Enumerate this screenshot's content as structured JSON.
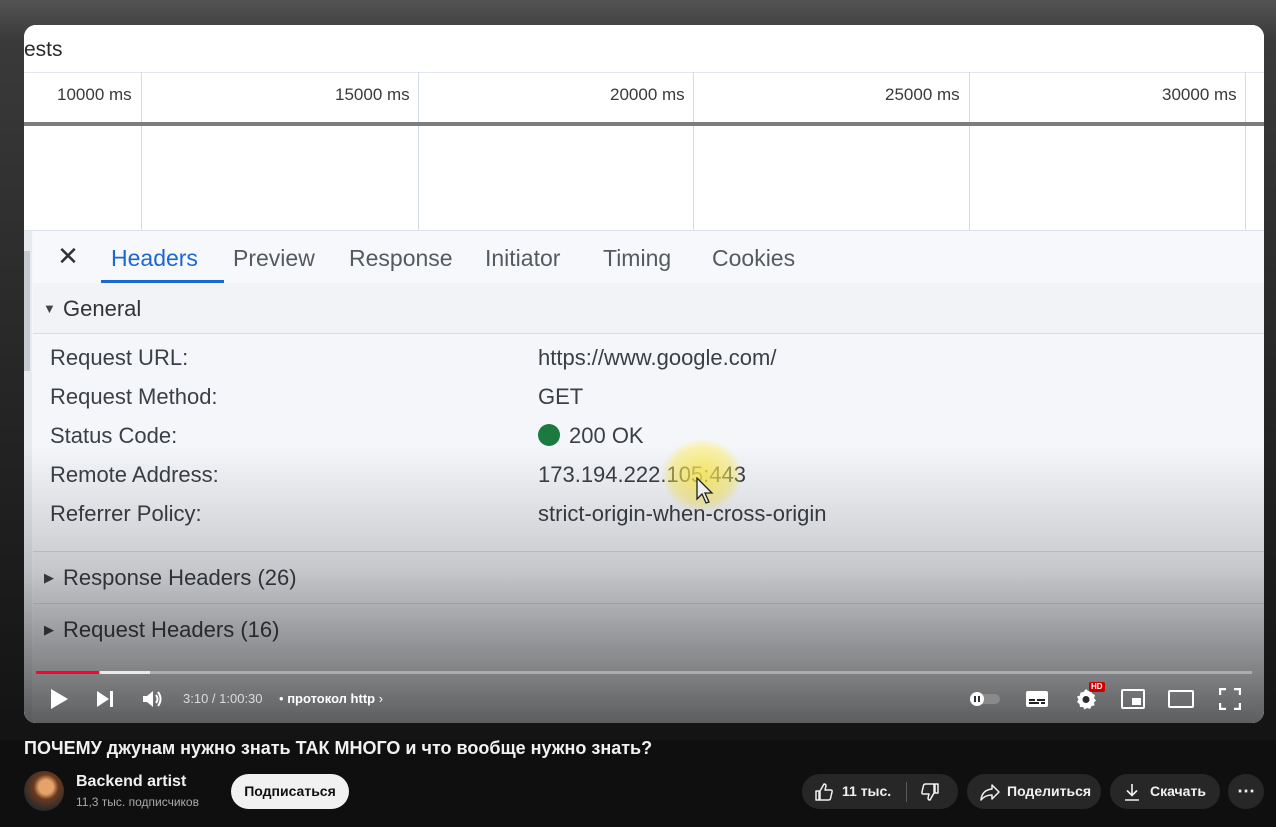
{
  "devtools": {
    "caption_fragment": "ests",
    "timeline_ticks": [
      "10000 ms",
      "15000 ms",
      "20000 ms",
      "25000 ms",
      "30000 ms"
    ],
    "tabs": [
      "Headers",
      "Preview",
      "Response",
      "Initiator",
      "Timing",
      "Cookies"
    ],
    "active_tab": "Headers",
    "general": {
      "title": "General",
      "rows": [
        {
          "key": "Request URL:",
          "value": "https://www.google.com/"
        },
        {
          "key": "Request Method:",
          "value": "GET"
        },
        {
          "key": "Status Code:",
          "value": "200 OK"
        },
        {
          "key": "Remote Address:",
          "value": "173.194.222.105:443"
        },
        {
          "key": "Referrer Policy:",
          "value": "strict-origin-when-cross-origin"
        }
      ]
    },
    "status_color": "#1b7a3f",
    "response_headers": "Response Headers (26)",
    "request_headers": "Request Headers (16)"
  },
  "player": {
    "time": "3:10 / 1:00:30",
    "chapter_sep": "•",
    "chapter": "протокол http",
    "progress_fraction": 0.052,
    "hd_badge": "HD",
    "accent": "#ff0033"
  },
  "video": {
    "title": "ПОЧЕМУ джунам нужно знать ТАК МНОГО и что вообще нужно знать?",
    "channel": "Backend artist",
    "subscribers": "11,3 тыс. подписчиков",
    "subscribe": "Подписаться",
    "likes": "11 тыс.",
    "share": "Поделиться",
    "download": "Скачать",
    "more": "⋯"
  }
}
